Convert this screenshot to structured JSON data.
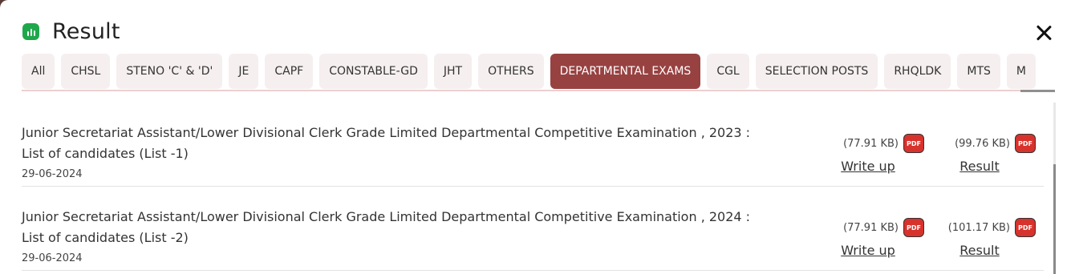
{
  "modal": {
    "title": "Result",
    "accent_color": "#1fa84b",
    "header_icon": "bar-chart-icon",
    "close_icon": "close-icon"
  },
  "tabs": [
    {
      "label": "All",
      "active": false
    },
    {
      "label": "CHSL",
      "active": false
    },
    {
      "label": "STENO 'C' & 'D'",
      "active": false
    },
    {
      "label": "JE",
      "active": false
    },
    {
      "label": "CAPF",
      "active": false
    },
    {
      "label": "CONSTABLE-GD",
      "active": false
    },
    {
      "label": "JHT",
      "active": false
    },
    {
      "label": "OTHERS",
      "active": false
    },
    {
      "label": "DEPARTMENTAL EXAMS",
      "active": true
    },
    {
      "label": "CGL",
      "active": false
    },
    {
      "label": "SELECTION POSTS",
      "active": false
    },
    {
      "label": "RHQLDK",
      "active": false
    },
    {
      "label": "MTS",
      "active": false
    },
    {
      "label": "M",
      "active": false
    }
  ],
  "active_tab_color": "#974241",
  "results": [
    {
      "title": "Junior Secretariat Assistant/Lower Divisional Clerk Grade Limited Departmental Competitive Examination , 2023 : List of candidates (List -1)",
      "date": "29-06-2024",
      "files": [
        {
          "size": "(77.91 KB)",
          "icon": "PDF",
          "label": "Write up"
        },
        {
          "size": "(99.76 KB)",
          "icon": "PDF",
          "label": "Result"
        }
      ]
    },
    {
      "title": "Junior Secretariat Assistant/Lower Divisional Clerk Grade Limited Departmental Competitive Examination , 2024 : List of candidates (List -2)",
      "date": "29-06-2024",
      "files": [
        {
          "size": "(77.91 KB)",
          "icon": "PDF",
          "label": "Write up"
        },
        {
          "size": "(101.17 KB)",
          "icon": "PDF",
          "label": "Result"
        }
      ]
    }
  ]
}
